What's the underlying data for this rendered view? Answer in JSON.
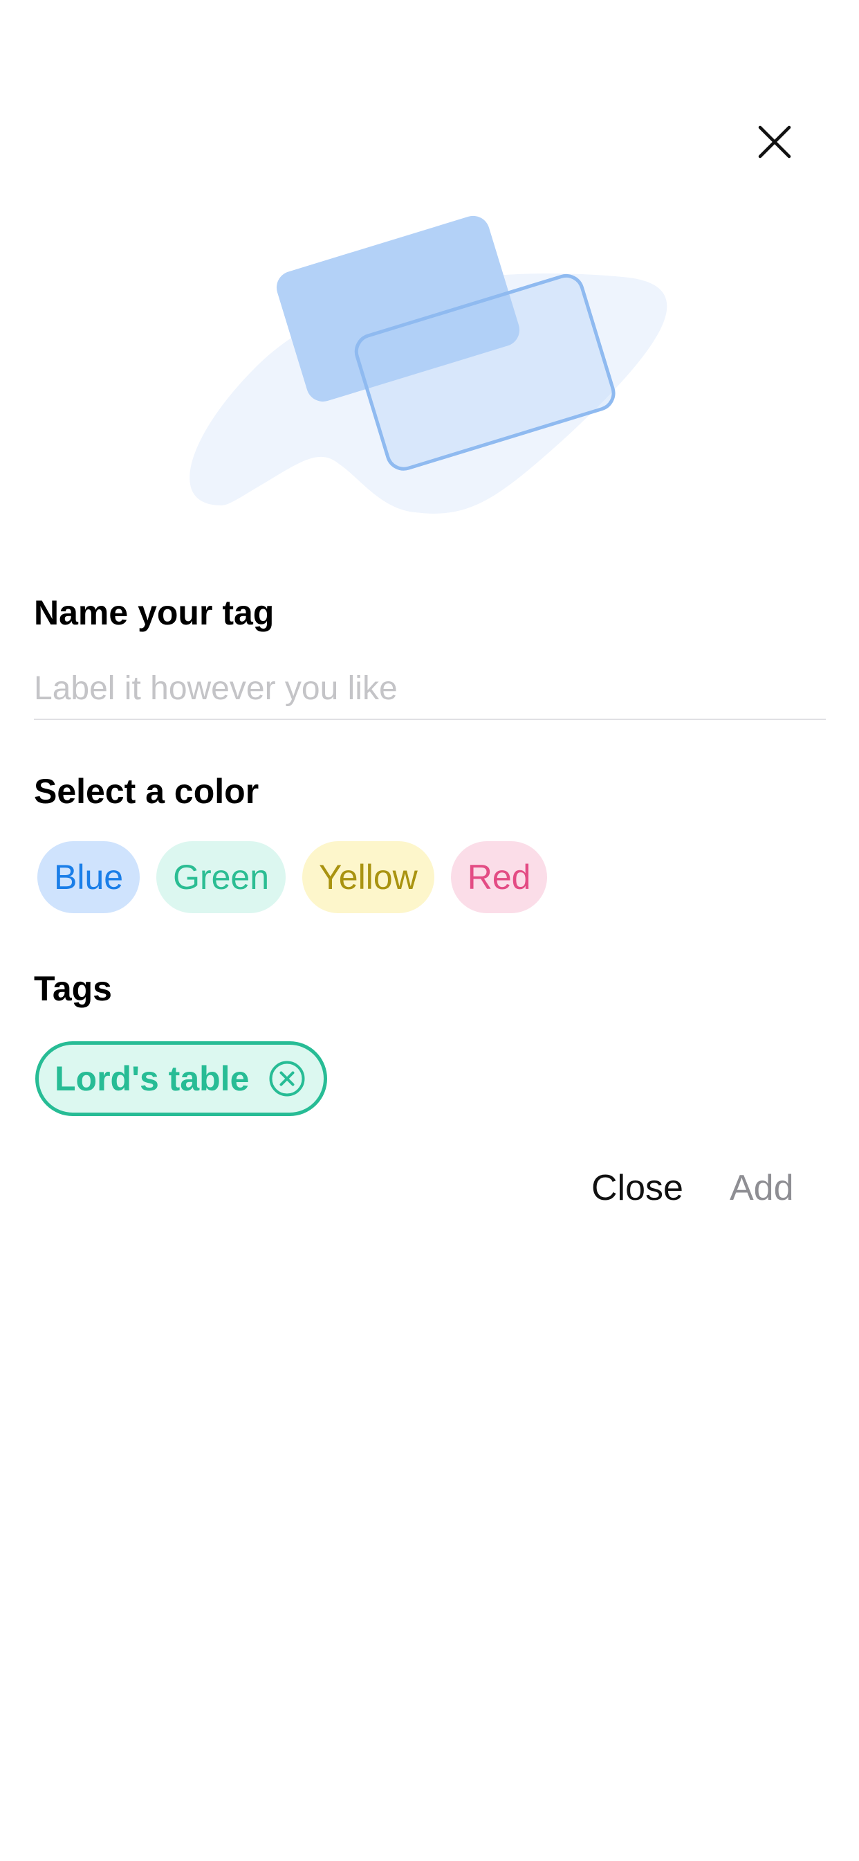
{
  "header": {
    "close_icon": "close-x-icon"
  },
  "illustration": {
    "icon": "tags-illustration",
    "colors": {
      "blob": "#eef4fd",
      "card_fill": "#b3d1f7",
      "card_outline": "#8fbaf0"
    }
  },
  "name_section": {
    "title": "Name your tag",
    "input_value": "",
    "placeholder": "Label it however you like"
  },
  "color_section": {
    "title": "Select a color",
    "options": [
      {
        "label": "Blue",
        "bg": "#cfe3fd",
        "fg": "#1a7ee8"
      },
      {
        "label": "Green",
        "bg": "#dcf7f0",
        "fg": "#2bbd93"
      },
      {
        "label": "Yellow",
        "bg": "#fdf6cb",
        "fg": "#a99310"
      },
      {
        "label": "Red",
        "bg": "#fbdde8",
        "fg": "#e34c84"
      }
    ]
  },
  "tags_section": {
    "title": "Tags",
    "items": [
      {
        "label": "Lord's table",
        "color": "#27bc95",
        "remove_icon": "remove-circle-x-icon"
      }
    ]
  },
  "footer": {
    "close_label": "Close",
    "add_label": "Add"
  }
}
